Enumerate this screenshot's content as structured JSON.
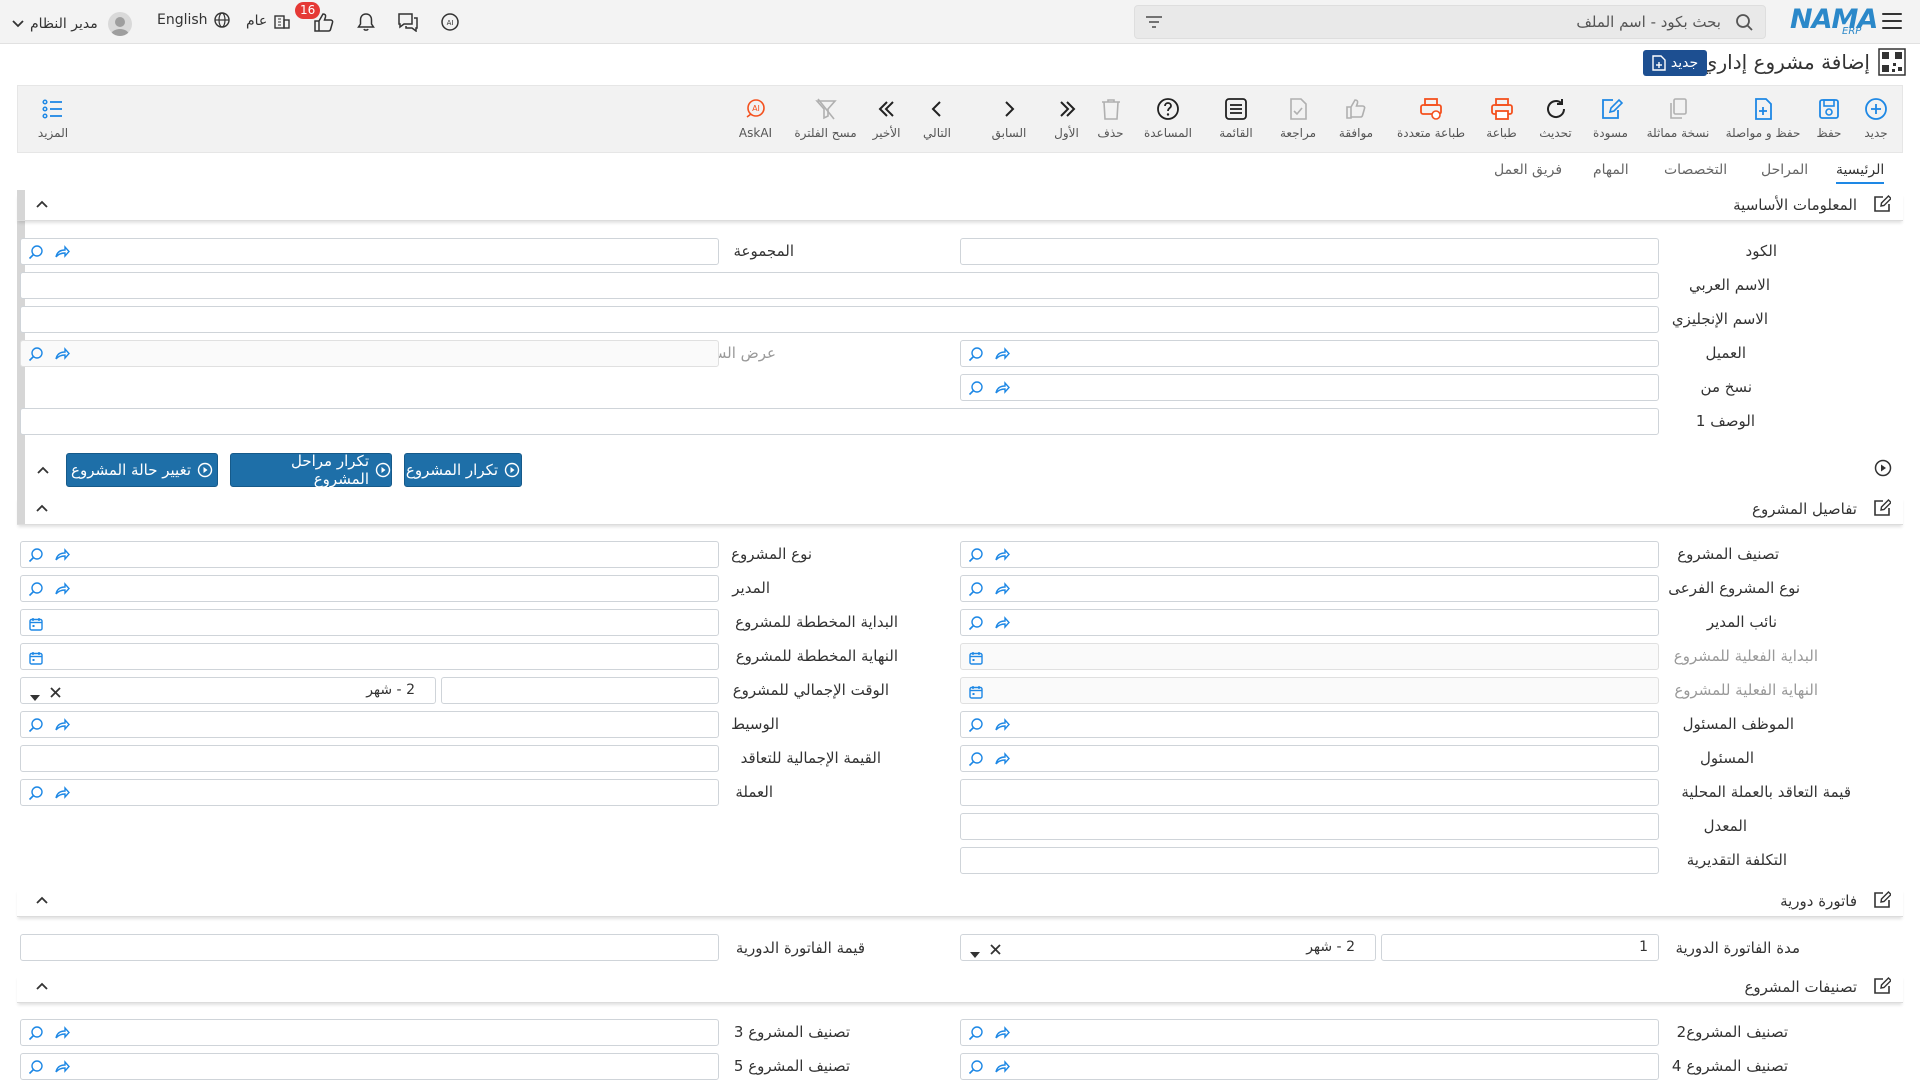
{
  "topbar": {
    "search_placeholder": "بحث بكود - اسم الملف",
    "user_name": "مدير النظام",
    "language": "English",
    "general_label": "عام",
    "notification_count": "16",
    "logo_text": "NAMA",
    "logo_sub": "ERP"
  },
  "page": {
    "title": "إضافة مشروع إداري",
    "new_badge": "جديد"
  },
  "toolbar": {
    "new": "جديد",
    "save": "حفظ",
    "save_continue": "حفظ و مواصلة",
    "duplicate": "نسخة مماثلة",
    "draft": "مسودة",
    "refresh": "تحديث",
    "print": "طباعة",
    "multi_print": "طباعة متعددة",
    "approve": "موافقة",
    "review": "مراجعة",
    "list": "القائمة",
    "help": "المساعدة",
    "delete": "حذف",
    "first": "الأول",
    "prev": "السابق",
    "next": "التالي",
    "last": "الأخير",
    "clear_filter": "مسح الفلترة",
    "askai": "AskAI",
    "more": "المزيد"
  },
  "tabs": [
    "الرئيسية",
    "المراحل",
    "التخصصات",
    "المهام",
    "فريق العمل"
  ],
  "sections": {
    "basic": "المعلومات الأساسية",
    "details": "تفاصيل المشروع",
    "periodic": "فاتورة دورية",
    "classifications": "تصنيفات المشروع"
  },
  "basic": {
    "code": "الكود",
    "group": "المجموعة",
    "arabic_name": "الاسم العربي",
    "english_name": "الاسم الإنجليزي",
    "customer": "العميل",
    "quotation": "عرض السعر",
    "copy_from": "نسخ من",
    "description": "الوصف 1"
  },
  "actions": {
    "repeat_project": "تكرار المشروع",
    "repeat_stages": "تكرار مراحل المشروع",
    "change_status": "تغيير حالة المشروع"
  },
  "details": {
    "classification": "تصنيف المشروع",
    "project_type": "نوع المشروع",
    "sub_type": "نوع المشروع الفرعى",
    "manager": "المدير",
    "deputy_manager": "نائب المدير",
    "planned_start": "البداية المخططة للمشروع",
    "actual_start": "البداية الفعلية للمشروع",
    "planned_end": "النهاية المخططة للمشروع",
    "actual_end": "النهاية الفعلية للمشروع",
    "total_time": "الوقت الإجمالي للمشروع",
    "total_time_unit": "2 - شهر",
    "responsible_employee": "الموظف المسئول",
    "broker": "الوسيط",
    "responsible": "المسئول",
    "total_contract_value": "القيمة الإجمالية للتعاقد",
    "local_contract_value": "قيمة التعاقد بالعملة المحلية",
    "currency": "العملة",
    "rate": "المعدل",
    "estimated_cost": "التكلفة التقديرية"
  },
  "periodic": {
    "duration": "مدة الفاتورة الدورية",
    "duration_value": "1",
    "duration_unit": "2 - شهر",
    "invoice_value": "قيمة الفاتورة الدورية"
  },
  "classifications": {
    "class2": "تصنيف المشروع2",
    "class3": "تصنيف المشروع 3",
    "class4": "تصنيف المشروع 4",
    "class5": "تصنيف المشروع 5"
  }
}
